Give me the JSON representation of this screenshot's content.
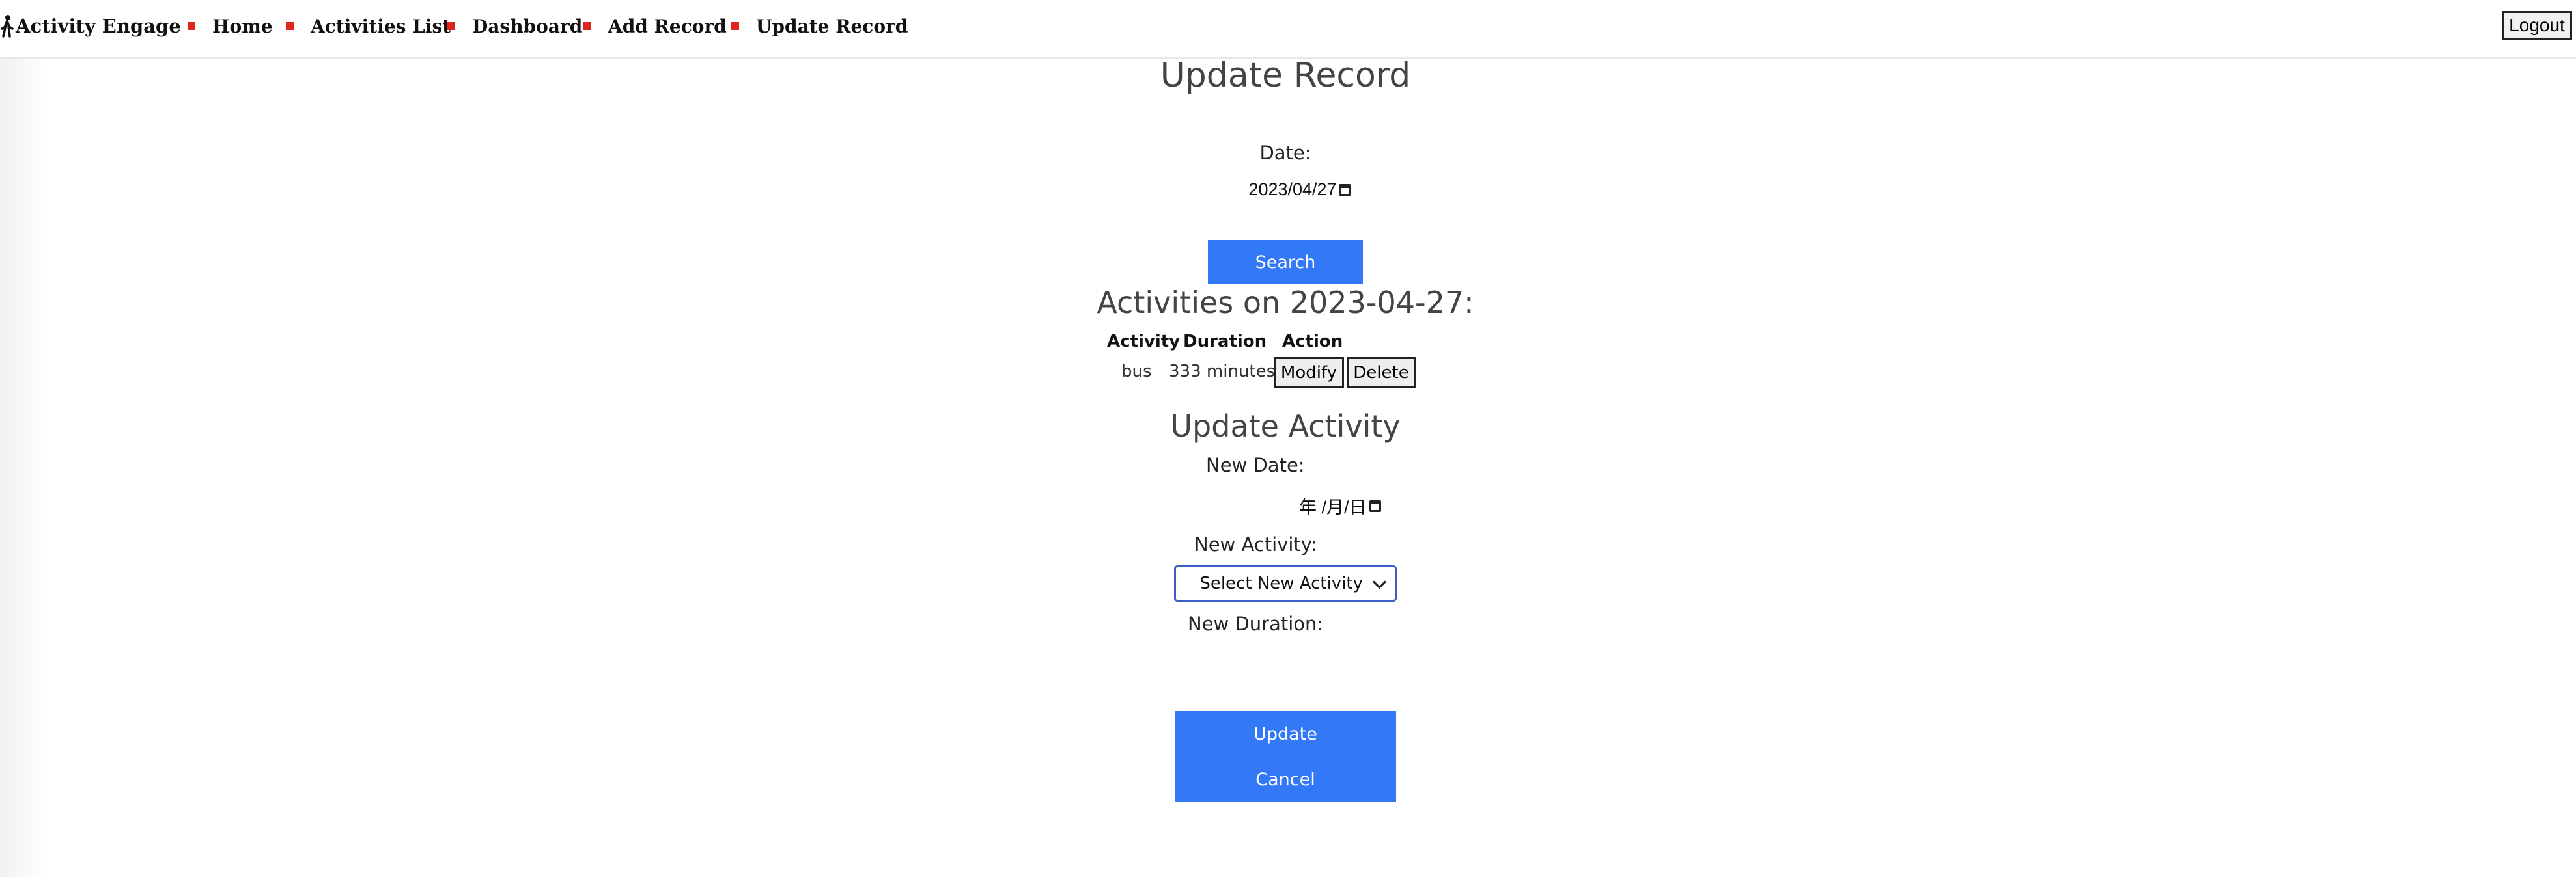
{
  "nav": {
    "brand": "Activity Engage",
    "items": [
      {
        "label": "Home"
      },
      {
        "label": "Activities List"
      },
      {
        "label": "Dashboard"
      },
      {
        "label": "Add Record"
      },
      {
        "label": "Update Record"
      }
    ],
    "logout": "Logout"
  },
  "search": {
    "title": "Update Record",
    "date_label": "Date:",
    "date_value": "2023/04/27",
    "search_button": "Search"
  },
  "results": {
    "heading": "Activities on 2023-04-27:",
    "columns": [
      "Activity",
      "Duration",
      "Action"
    ],
    "rows": [
      {
        "activity": "bus",
        "duration": "333 minutes",
        "modify": "Modify",
        "delete": "Delete"
      }
    ]
  },
  "update_form": {
    "title": "Update Activity",
    "new_date_label": "New Date:",
    "new_date_placeholder": "年 /月/日",
    "new_activity_label": "New Activity:",
    "new_activity_selected": "Select New Activity",
    "new_duration_label": "New Duration:",
    "update_button": "Update",
    "cancel_button": "Cancel"
  },
  "colors": {
    "accent": "#3378f6",
    "nav_bullet": "#e0261c",
    "select_border": "#3a5fc0"
  }
}
